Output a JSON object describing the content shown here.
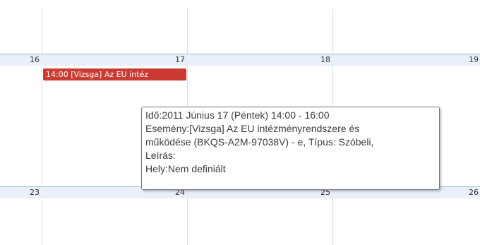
{
  "calendar": {
    "row_top": {
      "days": [
        "16",
        "17",
        "18",
        "19"
      ]
    },
    "row_bottom": {
      "days": [
        "23",
        "24",
        "25",
        "26"
      ]
    },
    "event": {
      "label": "14:00 [Vizsga] Az EU intéz"
    },
    "tooltip": {
      "line1": "Idő:2011 Június 17 (Péntek) 14:00 -  16:00",
      "line2": "Esemény:[Vizsga] Az EU intézményrendszere és",
      "line3": "működése (BKQS-A2M-97038V)  - e, Típus: Szóbeli,",
      "line4": "Leírás:",
      "line5": "Hely:Nem definiált"
    },
    "colors": {
      "event_bg": "#cc3b33",
      "header_band": "#e9f0f9",
      "grid_line": "#d3deee"
    }
  }
}
